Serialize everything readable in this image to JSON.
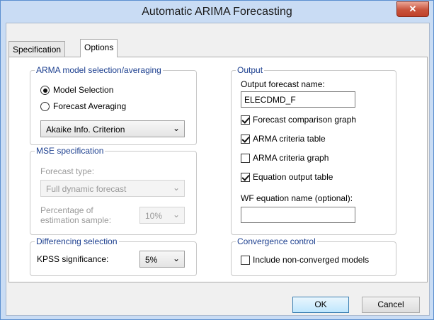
{
  "window": {
    "title": "Automatic ARIMA Forecasting",
    "close_glyph": "✕"
  },
  "tabs": [
    {
      "label": "Specification"
    },
    {
      "label": "Options"
    }
  ],
  "arma": {
    "title": "ARMA model selection/averaging",
    "options": [
      {
        "label": "Model Selection"
      },
      {
        "label": "Forecast Averaging"
      }
    ],
    "criterion": "Akaike Info. Criterion"
  },
  "mse": {
    "title": "MSE specification",
    "forecast_type_label": "Forecast type:",
    "forecast_type_value": "Full dynamic forecast",
    "percentage_label_line1": "Percentage of",
    "percentage_label_line2": "estimation sample:",
    "percentage_value": "10%"
  },
  "differencing": {
    "title": "Differencing selection",
    "kpss_label": "KPSS significance:",
    "kpss_value": "5%"
  },
  "output": {
    "title": "Output",
    "forecast_name_label": "Output forecast name:",
    "forecast_name_value": "ELECDMD_F",
    "checks": [
      {
        "label": "Forecast comparison graph"
      },
      {
        "label": "ARMA criteria table"
      },
      {
        "label": "ARMA criteria graph"
      },
      {
        "label": "Equation output table"
      }
    ],
    "wf_label": "WF equation name (optional):",
    "wf_value": ""
  },
  "convergence": {
    "title": "Convergence control",
    "include_label": "Include non-converged models"
  },
  "buttons": {
    "ok": "OK",
    "cancel": "Cancel"
  },
  "icons": {
    "chevron": "⌄"
  }
}
